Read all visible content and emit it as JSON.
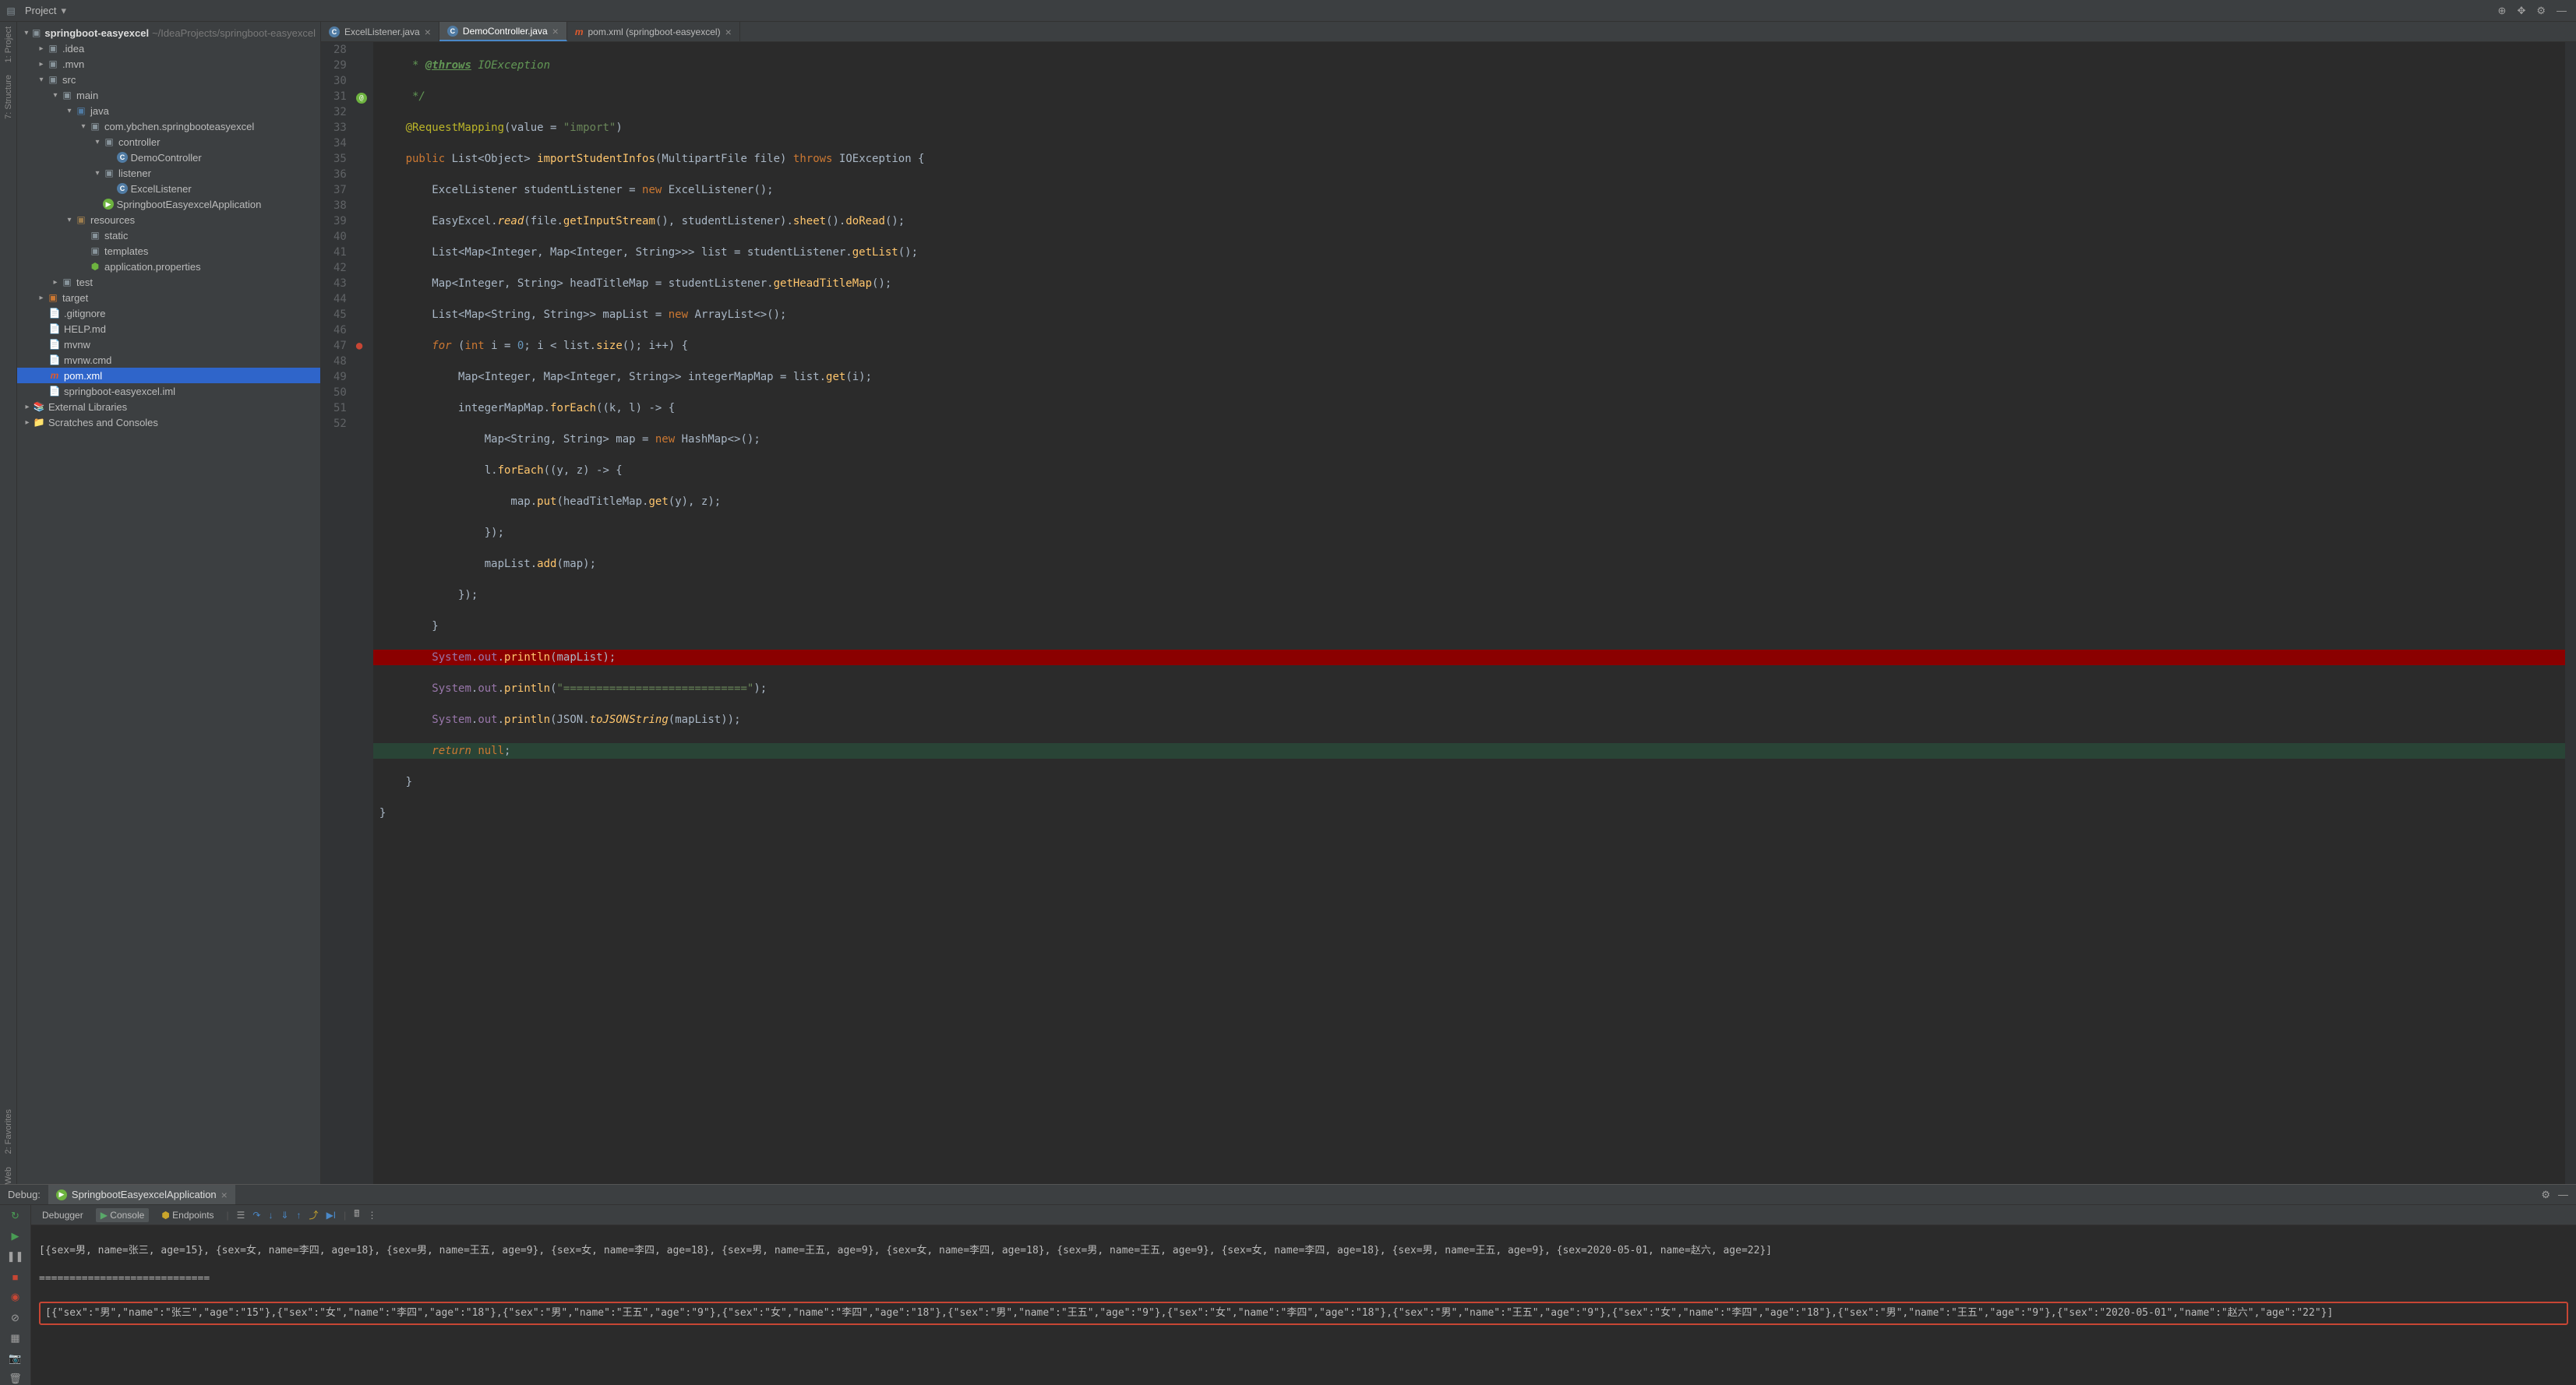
{
  "topbar": {
    "project_label": "Project",
    "arrow": "▾"
  },
  "sidebar": {
    "root": {
      "name": "springboot-easyexcel",
      "path": "~/IdeaProjects/springboot-easyexcel"
    },
    "idea": ".idea",
    "mvn": ".mvn",
    "src": "src",
    "main": "main",
    "java": "java",
    "pkg": "com.ybchen.springbooteasyexcel",
    "controller": "controller",
    "demoController": "DemoController",
    "listener": "listener",
    "excelListener": "ExcelListener",
    "springApp": "SpringbootEasyexcelApplication",
    "resources": "resources",
    "static": "static",
    "templates": "templates",
    "appProps": "application.properties",
    "test": "test",
    "target": "target",
    "gitignore": ".gitignore",
    "help": "HELP.md",
    "mvnw": "mvnw",
    "mvnwcmd": "mvnw.cmd",
    "pom": "pom.xml",
    "iml": "springboot-easyexcel.iml",
    "extlib": "External Libraries",
    "scratches": "Scratches and Consoles"
  },
  "tabs": {
    "t1": "ExcelListener.java",
    "t2": "DemoController.java",
    "t3": "pom.xml (springboot-easyexcel)"
  },
  "editor": {
    "lines": [
      "28",
      "29",
      "30",
      "31",
      "32",
      "33",
      "34",
      "35",
      "36",
      "37",
      "38",
      "39",
      "40",
      "41",
      "42",
      "43",
      "44",
      "45",
      "46",
      "47",
      "48",
      "49",
      "50",
      "51",
      "52"
    ]
  },
  "debug": {
    "title": "Debug:",
    "runconfig": "SpringbootEasyexcelApplication",
    "tabs": {
      "debugger": "Debugger",
      "console": "Console",
      "endpoints": "Endpoints"
    },
    "console_line1": "[{sex=男, name=张三, age=15}, {sex=女, name=李四, age=18}, {sex=男, name=王五, age=9}, {sex=女, name=李四, age=18}, {sex=男, name=王五, age=9}, {sex=女, name=李四, age=18}, {sex=男, name=王五, age=9}, {sex=女, name=李四, age=18}, {sex=男, name=王五, age=9}, {sex=2020-05-01, name=赵六, age=22}]",
    "console_line2": "============================",
    "console_line3": "[{\"sex\":\"男\",\"name\":\"张三\",\"age\":\"15\"},{\"sex\":\"女\",\"name\":\"李四\",\"age\":\"18\"},{\"sex\":\"男\",\"name\":\"王五\",\"age\":\"9\"},{\"sex\":\"女\",\"name\":\"李四\",\"age\":\"18\"},{\"sex\":\"男\",\"name\":\"王五\",\"age\":\"9\"},{\"sex\":\"女\",\"name\":\"李四\",\"age\":\"18\"},{\"sex\":\"男\",\"name\":\"王五\",\"age\":\"9\"},{\"sex\":\"女\",\"name\":\"李四\",\"age\":\"18\"},{\"sex\":\"男\",\"name\":\"王五\",\"age\":\"9\"},{\"sex\":\"2020-05-01\",\"name\":\"赵六\",\"age\":\"22\"}]"
  },
  "leftgutter": {
    "project": "1: Project",
    "structure": "7: Structure",
    "favorites": "2: Favorites",
    "web": "Web"
  }
}
